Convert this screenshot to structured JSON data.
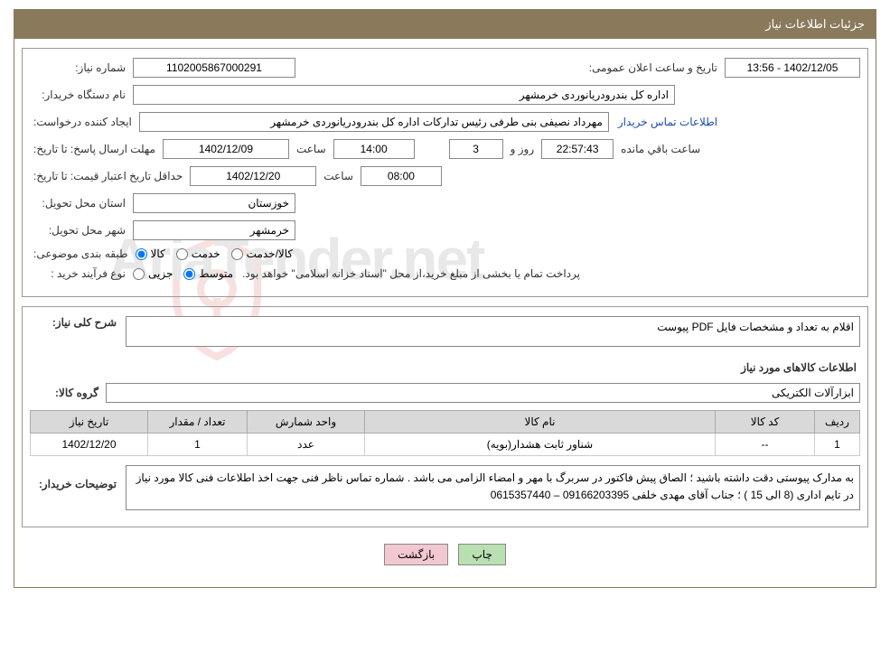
{
  "header": {
    "title": "جزئیات اطلاعات نیاز"
  },
  "info": {
    "need_no_label": "شماره نیاز:",
    "need_no": "1102005867000291",
    "announce_label": "تاریخ و ساعت اعلان عمومی:",
    "announce_value": "1402/12/05 - 13:56",
    "buyer_org_label": "نام دستگاه خریدار:",
    "buyer_org": "اداره کل بندرودریانوردی خرمشهر",
    "requester_label": "ایجاد کننده درخواست:",
    "requester": "مهرداد  نصیفی بنی طرفی رئیس تدارکات اداره کل بندرودریانوردی خرمشهر",
    "buyer_contact_link": "اطلاعات تماس خریدار",
    "deadline_label": "مهلت ارسال پاسخ:",
    "deadline_date_prefix": "تا تاریخ:",
    "deadline_date": "1402/12/09",
    "time_label": "ساعت",
    "deadline_time": "14:00",
    "days": "3",
    "days_and": "روز و",
    "countdown": "22:57:43",
    "remaining": "ساعت باقي مانده",
    "min_validity_label": "حداقل تاریخ اعتبار قیمت:",
    "min_validity_prefix": "تا تاریخ:",
    "min_validity_date": "1402/12/20",
    "min_validity_time": "08:00",
    "province_label": "استان محل تحویل:",
    "province": "خوزستان",
    "city_label": "شهر محل تحویل:",
    "city": "خرمشهر",
    "category_label": "طبقه بندی موضوعی:",
    "cat_kala": "کالا",
    "cat_khedmat": "خدمت",
    "cat_kalakhedmat": "کالا/خدمت",
    "purchase_type_label": "نوع فرآیند خرید :",
    "pt_jozi": "جزیی",
    "pt_motavaset": "متوسط",
    "purchase_note": "پرداخت تمام یا بخشی از مبلغ خرید،از محل \"اسناد خزانه اسلامی\" خواهد بود."
  },
  "need": {
    "desc_label": "شرح کلی نیاز:",
    "desc": "اقلام به تعداد و مشخصات فایل PDF پیوست",
    "items_title": "اطلاعات کالاهای مورد نیاز",
    "group_label": "گروه کالا:",
    "group": "ابزارآلات الکتریکی"
  },
  "table": {
    "headers": {
      "row": "ردیف",
      "code": "کد کالا",
      "name": "نام کالا",
      "unit": "واحد شمارش",
      "qty": "تعداد / مقدار",
      "date": "تاریخ نیاز"
    },
    "rows": [
      {
        "row": "1",
        "code": "--",
        "name": "شناور ثابت هشدار(بویه)",
        "unit": "عدد",
        "qty": "1",
        "date": "1402/12/20"
      }
    ]
  },
  "buyer_notes": {
    "label": "توضیحات خریدار:",
    "text": "به مدارک پیوستی دقت داشته باشید ؛ الصاق پیش فاکتور در سربرگ با مهر و امضاء الزامی می باشد . شماره تماس ناظر فنی جهت اخذ اطلاعات فنی کالا مورد نیاز در تایم اداری (8 الی 15 ) ؛ جناب آقای مهدی خلفی 09166203395 – 0615357440"
  },
  "buttons": {
    "print": "چاپ",
    "back": "بازگشت"
  },
  "watermark": "AriaTender.net"
}
